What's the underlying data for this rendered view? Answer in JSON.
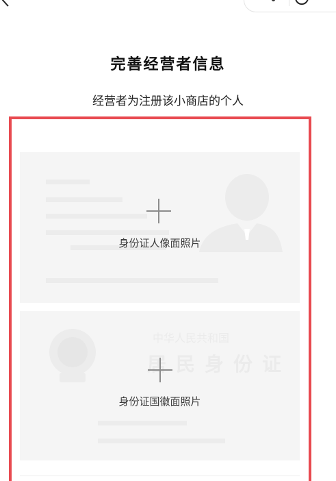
{
  "header": {
    "back_icon": "chevron-left-icon",
    "more_icon": "more-dots-icon",
    "close_icon": "circle-icon"
  },
  "title": "完善经营者信息",
  "subtitle": "经营者为注册该小商店的个人",
  "upload": {
    "front": {
      "label": "身份证人像面照片",
      "icon": "plus-icon"
    },
    "back": {
      "label": "身份证国徽面照片",
      "icon": "plus-icon",
      "watermark_title": "中华人民共和国",
      "watermark_subtitle": "居民身份证"
    }
  },
  "colors": {
    "highlight_border": "#e84a50",
    "card_background": "#f5f5f5"
  }
}
